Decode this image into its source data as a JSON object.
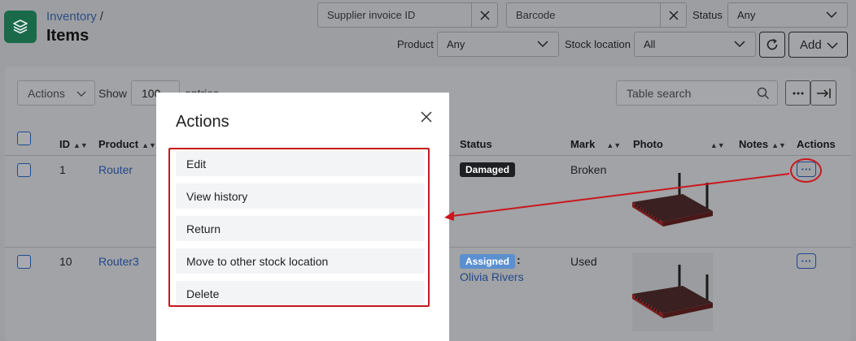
{
  "header": {
    "breadcrumb": "Inventory",
    "breadcrumb_sep": "/",
    "title": "Items"
  },
  "filters": {
    "supplier_invoice_placeholder": "Supplier invoice ID",
    "barcode_placeholder": "Barcode",
    "status_label": "Status",
    "status_value": "Any",
    "product_label": "Product",
    "product_value": "Any",
    "stock_location_label": "Stock location",
    "stock_location_value": "All",
    "add_label": "Add"
  },
  "toolbar": {
    "actions_label": "Actions",
    "show_label": "Show",
    "entries_value": "100",
    "entries_label": "entries",
    "search_placeholder": "Table search"
  },
  "table": {
    "columns": {
      "id": "ID",
      "product": "Product",
      "status": "Status",
      "mark": "Mark",
      "photo": "Photo",
      "notes": "Notes",
      "actions": "Actions"
    },
    "rows": [
      {
        "id": "1",
        "product": "Router",
        "status": "Damaged",
        "status_color": "#1d1f22",
        "mark": "Broken"
      },
      {
        "id": "10",
        "product": "Router3",
        "status": "Assigned",
        "status_color": "#5b8fd0",
        "status_suffix": ":",
        "assignee": "Olivia Rivers",
        "mark": "Used"
      }
    ]
  },
  "modal": {
    "title": "Actions",
    "items": [
      "Edit",
      "View history",
      "Return",
      "Move to other stock location",
      "Delete"
    ]
  },
  "colors": {
    "highlight": "#c8181e",
    "link": "#23488a"
  },
  "icons": [
    "layers-icon",
    "close-icon",
    "chevron-down-icon",
    "refresh-icon",
    "search-icon",
    "more-icon",
    "expand-icon",
    "sort-icon",
    "router-image"
  ]
}
